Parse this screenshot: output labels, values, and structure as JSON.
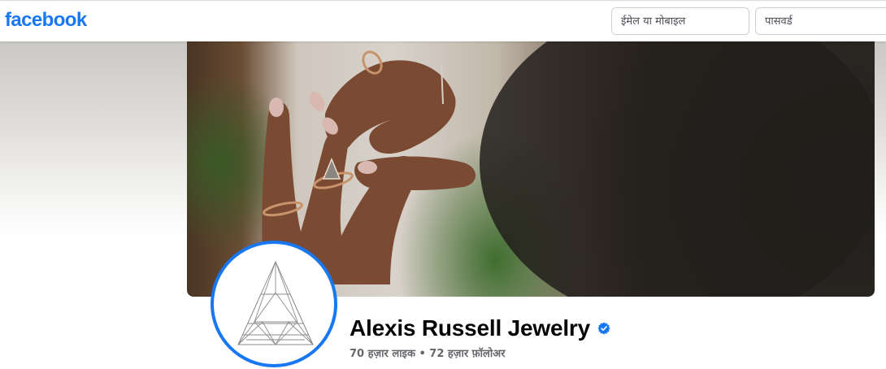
{
  "header": {
    "logo_text": "facebook",
    "email_placeholder": "ईमेल या मोबाइल",
    "password_placeholder": "पासवर्ड"
  },
  "page": {
    "name": "Alexis Russell Jewelry",
    "stats": "70 हज़ार लाइक • 72 हज़ार फ़ॉलोअर"
  },
  "colors": {
    "brand_blue": "#1877f2",
    "text_primary": "#050505",
    "text_secondary": "#65676b"
  },
  "icons": {
    "verified": "verified-badge-icon",
    "profile_logo": "triangle-gem-logo"
  }
}
